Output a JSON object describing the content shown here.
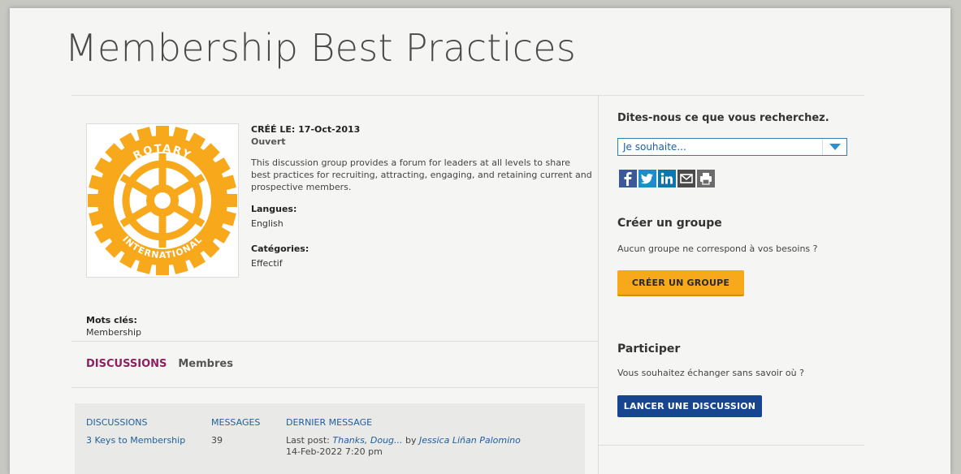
{
  "page": {
    "title": "Membership Best Practices"
  },
  "group": {
    "created": "CRÉÉ LE: 17-Oct-2013",
    "status": "Ouvert",
    "description": "This discussion group provides a forum for leaders at all levels to share best practices for recruiting, attracting, engaging, and retaining current and prospective members.",
    "languages_label": "Langues:",
    "languages_value": "English",
    "categories_label": "Catégories:",
    "categories_value": "Effectif",
    "keywords_label": "Mots clés:",
    "keywords_value": "Membership",
    "logo_text_top": "ROTARY",
    "logo_text_bottom": "INTERNATIONAL"
  },
  "tabs": {
    "discussions": "DISCUSSIONS",
    "members": "Membres"
  },
  "table": {
    "headers": [
      "DISCUSSIONS",
      "MESSAGES",
      "DERNIER MESSAGE"
    ],
    "rows": [
      {
        "title": "3 Keys to Membership",
        "messages": "39",
        "last_post_prefix": "Last post:",
        "last_post_subject": "Thanks, Doug...",
        "by": "by",
        "author": "Jessica Liñan Palomino",
        "date": "14-Feb-2022 7:20 pm"
      }
    ]
  },
  "sidebar": {
    "search_heading": "Dites-nous ce que vous recherchez.",
    "select_value": "Je souhaite...",
    "create_heading": "Créer un groupe",
    "create_text": "Aucun groupe ne correspond à vos besoins ?",
    "create_button": "CRÉER UN GROUPE",
    "join_heading": "Participer",
    "join_text": "Vous souhaitez échanger sans savoir où ?",
    "join_button": "LANCER UNE DISCUSSION"
  },
  "colors": {
    "rotary_gold": "#f7a81b",
    "rotary_blue": "#17458f",
    "tab_active": "#8c2161",
    "link_blue": "#1f5f9a"
  },
  "icons": [
    "facebook-icon",
    "twitter-icon",
    "linkedin-icon",
    "email-icon",
    "print-icon",
    "chevron-down-icon"
  ]
}
